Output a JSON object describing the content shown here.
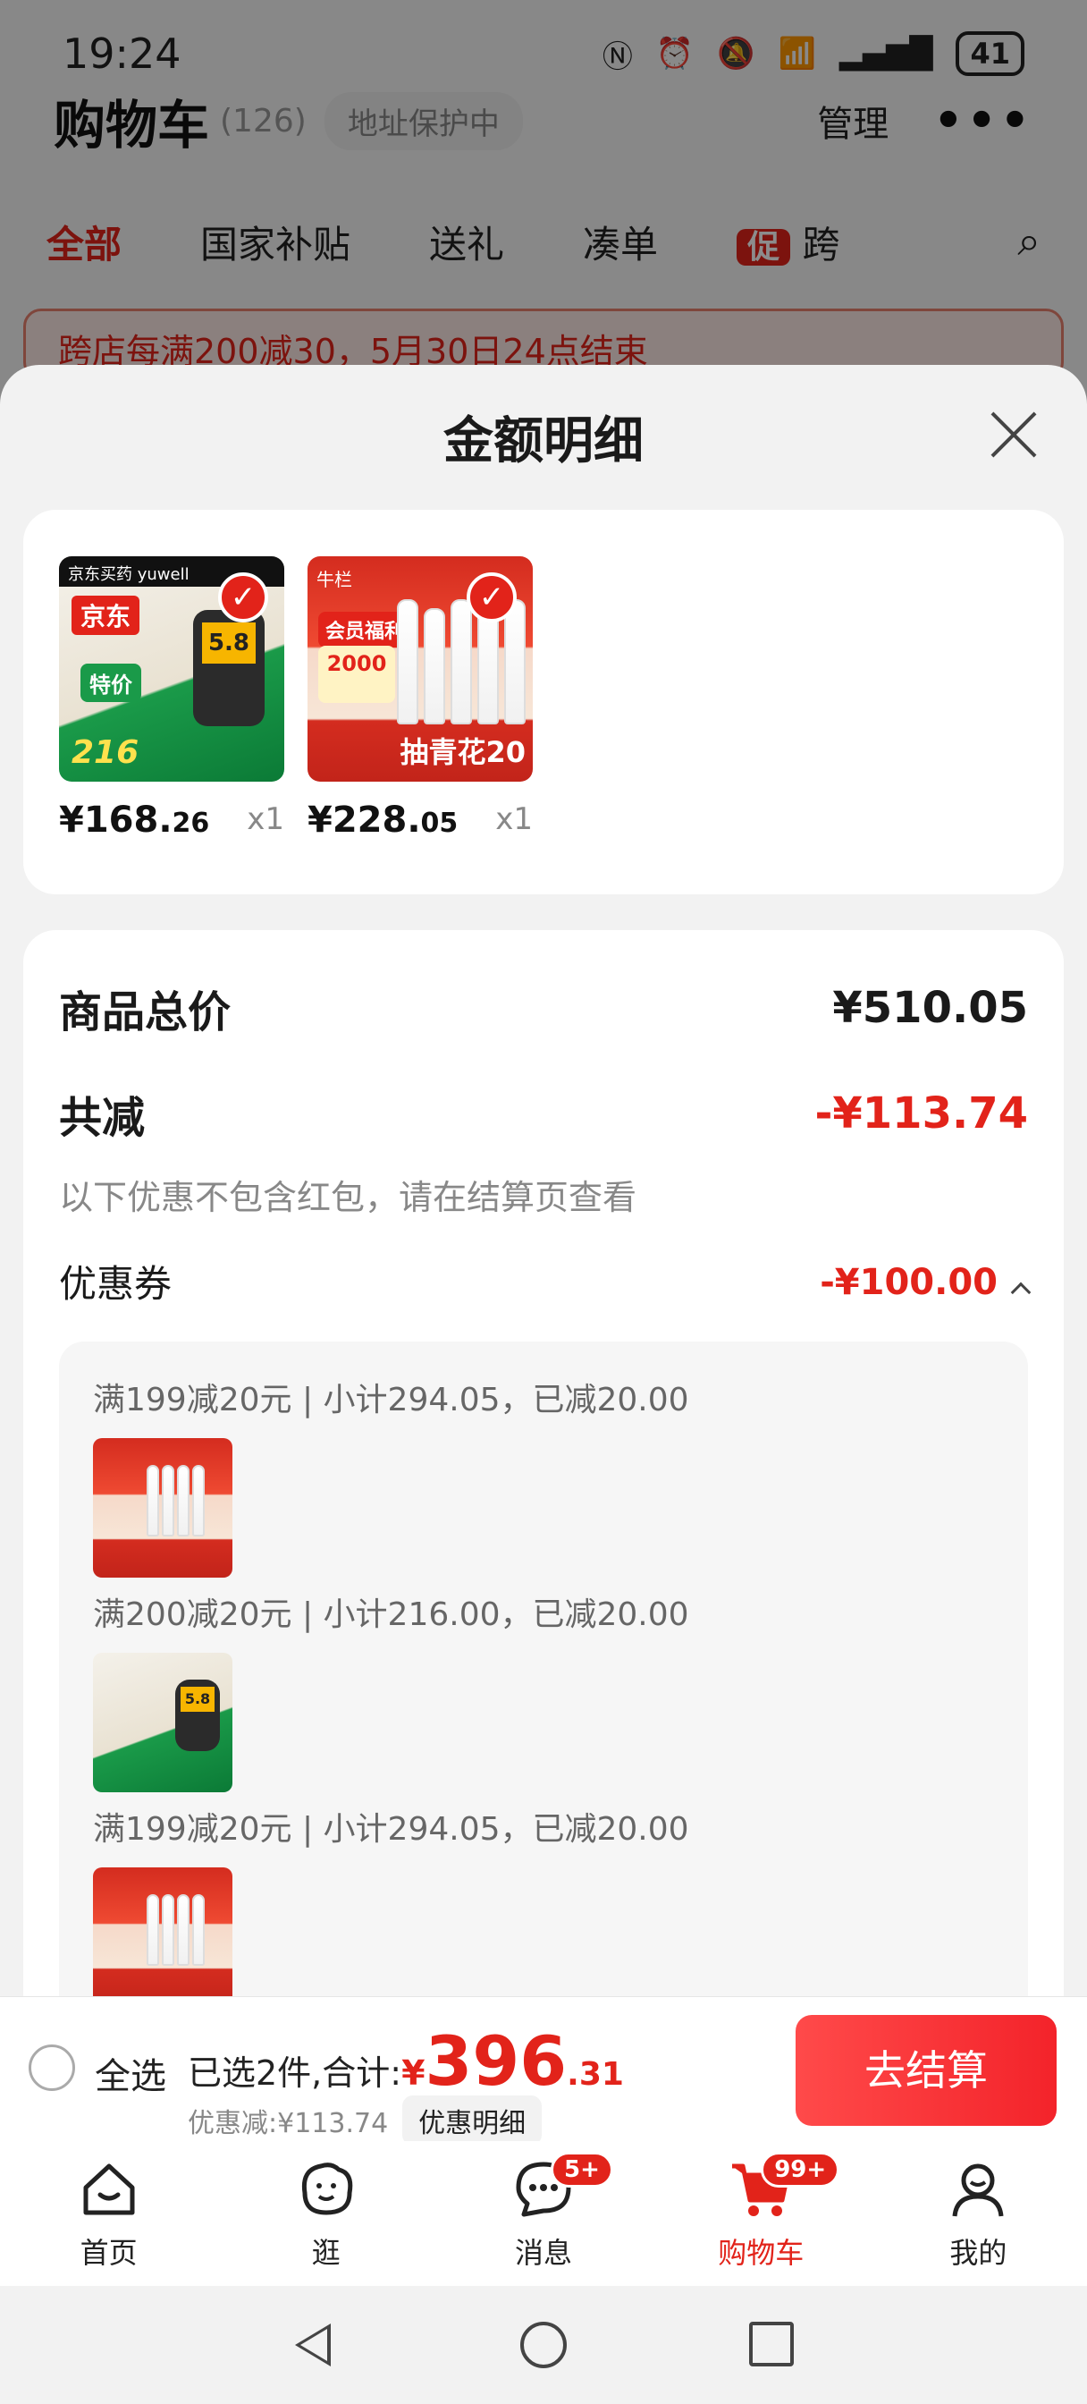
{
  "status_bar": {
    "time": "19:24",
    "battery": "41"
  },
  "background": {
    "header_title": "购物车",
    "header_count": "(126)",
    "address_protect": "地址保护中",
    "manage": "管理",
    "tabs": [
      "全部",
      "国家补贴",
      "送礼",
      "凑单"
    ],
    "promo_tag": "促",
    "promo_tab": "跨",
    "banner": "跨店每满200减30，5月30日24点结束"
  },
  "sheet": {
    "title": "金额明细",
    "products": [
      {
        "price_int": "¥168.",
        "price_dec": "26",
        "qty": "x1",
        "image": "glucose-meter-product",
        "img_text": {
          "brand": "京东买药  yuwell",
          "tag": "京东",
          "screen": "5.8",
          "special": "特价",
          "bottom": "216"
        }
      },
      {
        "price_int": "¥228.",
        "price_dec": "05",
        "qty": "x1",
        "image": "liquor-bottles-product",
        "img_text": {
          "top": "牛栏",
          "badge": "会员福利",
          "gold": "2000",
          "draw": "抽青花20"
        }
      }
    ],
    "total_label": "商品总价",
    "total_value": "¥510.05",
    "discount_label": "共减",
    "discount_value": "-¥113.74",
    "note": "以下优惠不包含红包，请在结算页查看",
    "coupon_label": "优惠券",
    "coupon_value": "-¥100.00",
    "coupon_lines": [
      "满199减20元 | 小计294.05，已减20.00",
      "满200减20元 | 小计216.00，已减20.00",
      "满199减20元 | 小计294.05，已减20.00"
    ]
  },
  "bottom_bar": {
    "select_all": "全选",
    "selected_text": "已选2件,合计:",
    "yen": "¥",
    "amount_int": "396",
    "amount_dec": ".31",
    "saved": "优惠减:¥113.74",
    "detail_button": "优惠明细",
    "checkout": "去结算"
  },
  "tabbar": [
    {
      "label": "首页",
      "icon": "home-icon"
    },
    {
      "label": "逛",
      "icon": "browse-icon"
    },
    {
      "label": "消息",
      "icon": "message-icon",
      "badge": "5+"
    },
    {
      "label": "购物车",
      "icon": "cart-icon",
      "badge": "99+",
      "active": true
    },
    {
      "label": "我的",
      "icon": "profile-icon"
    }
  ],
  "colors": {
    "accent": "#e2231a",
    "checkout_start": "#ff4a4a",
    "checkout_end": "#f3232a"
  }
}
